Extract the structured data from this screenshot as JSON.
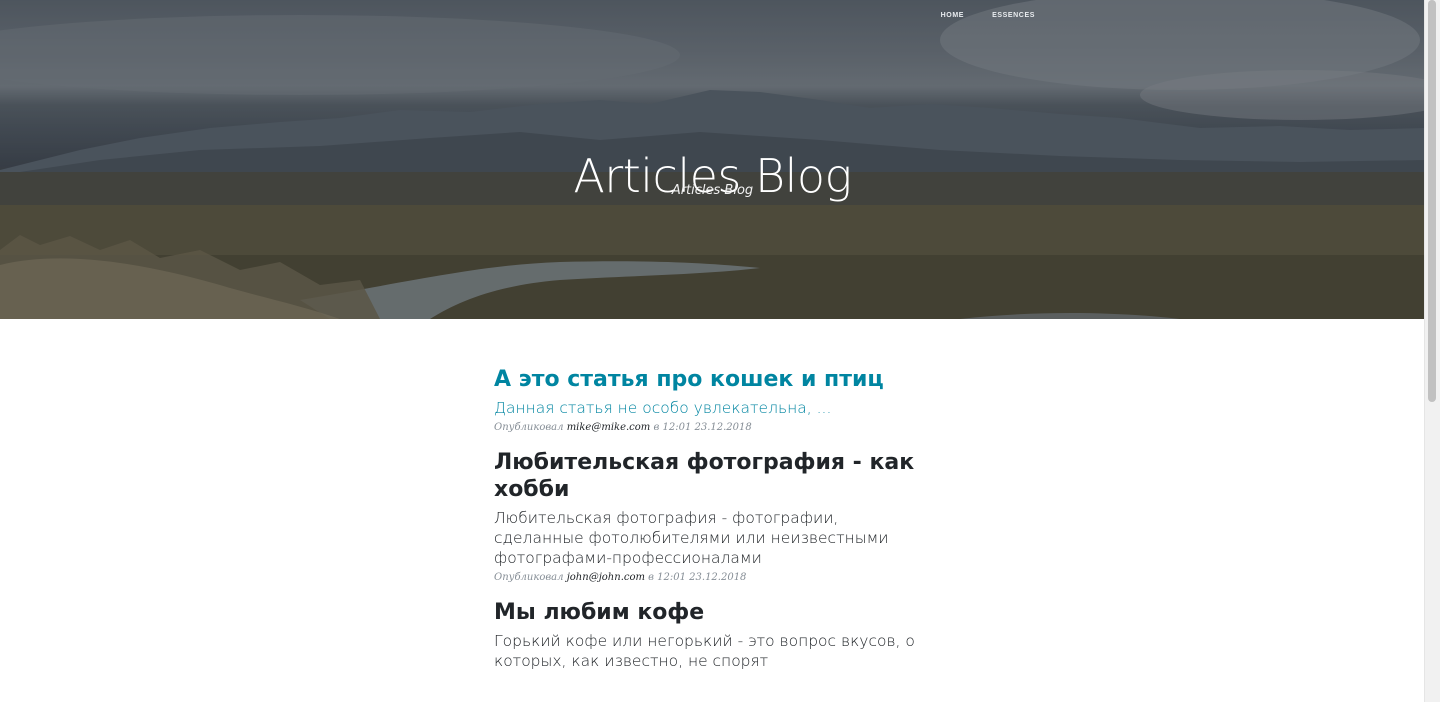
{
  "nav": {
    "items": [
      {
        "label": "HOME"
      },
      {
        "label": "ESSENCES"
      }
    ]
  },
  "hero": {
    "title": "Articles Blog",
    "subtitle": "Articles Blog"
  },
  "posts": [
    {
      "title": "А это статья про кошек и птиц",
      "subtitle": "Данная статья не особо увлекательна, ...",
      "meta_prefix": "Опубликовал",
      "author": "mike@mike.com",
      "meta_suffix": "в 12:01 23.12.2018",
      "hovered": true
    },
    {
      "title": "Любительская фотография - как хобби",
      "subtitle": "Любительская фотография - фотографии, сделанные фотолюбителями или неизвестными фотографами-профессионалами",
      "meta_prefix": "Опубликовал",
      "author": "john@john.com",
      "meta_suffix": "в 12:01 23.12.2018",
      "hovered": false
    },
    {
      "title": "Мы любим кофе",
      "subtitle": "Горький кофе или негорький - это вопрос вкусов, о которых, как известно, не спорят",
      "hovered": false
    }
  ],
  "colors": {
    "link_active": "#0085a1",
    "text": "#212529",
    "meta": "#868e96"
  }
}
